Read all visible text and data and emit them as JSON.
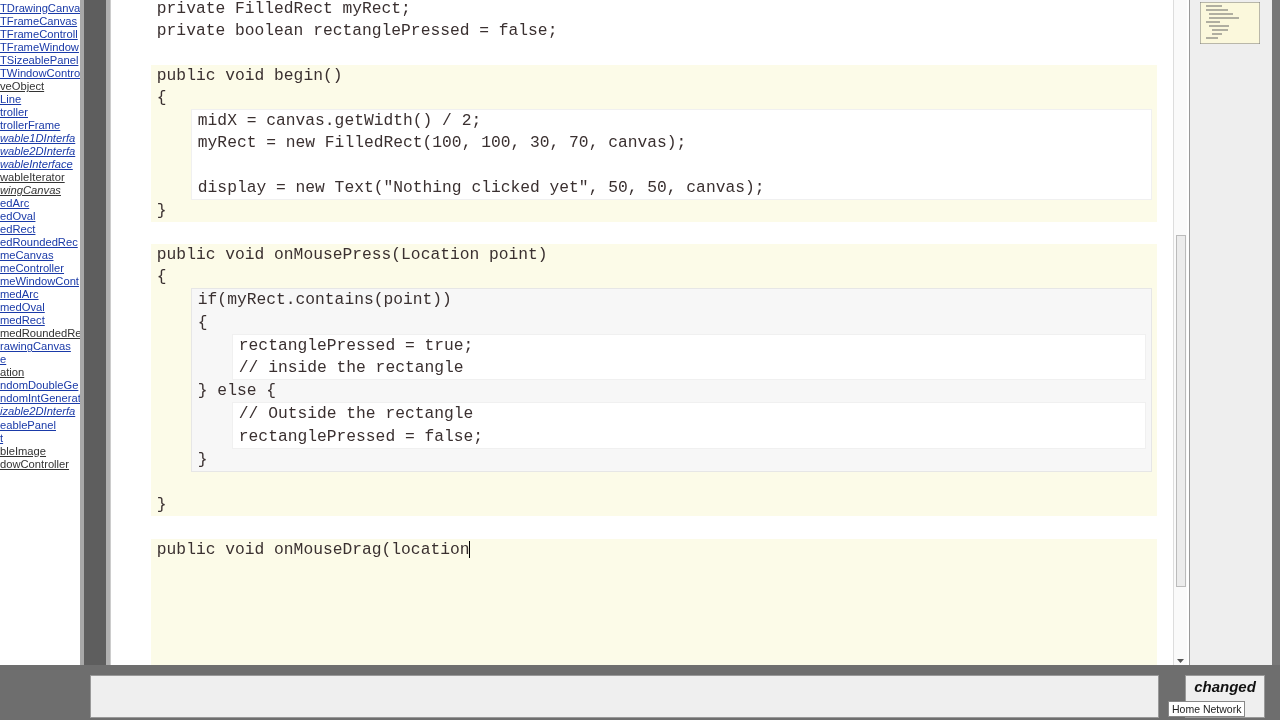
{
  "class_list": [
    {
      "text": "TDrawingCanva",
      "italic": false,
      "visited": false
    },
    {
      "text": "TFrameCanvas",
      "italic": false,
      "visited": false
    },
    {
      "text": "TFrameControll",
      "italic": false,
      "visited": false
    },
    {
      "text": "TFrameWindow",
      "italic": false,
      "visited": false
    },
    {
      "text": "TSizeablePanel",
      "italic": false,
      "visited": false
    },
    {
      "text": "TWindowContro",
      "italic": false,
      "visited": false
    },
    {
      "text": "veObject",
      "italic": false,
      "visited": true
    },
    {
      "text": "Line",
      "italic": false,
      "visited": false
    },
    {
      "text": "troller",
      "italic": false,
      "visited": false
    },
    {
      "text": "trollerFrame",
      "italic": false,
      "visited": false
    },
    {
      "text": "wable1DInterfa",
      "italic": true,
      "visited": false
    },
    {
      "text": "wable2DInterfa",
      "italic": true,
      "visited": false
    },
    {
      "text": "wableInterface",
      "italic": true,
      "visited": false
    },
    {
      "text": "wableIterator",
      "italic": false,
      "visited": true
    },
    {
      "text": "wingCanvas",
      "italic": true,
      "visited": true
    },
    {
      "text": "edArc",
      "italic": false,
      "visited": false
    },
    {
      "text": "edOval",
      "italic": false,
      "visited": false
    },
    {
      "text": "edRect",
      "italic": false,
      "visited": false
    },
    {
      "text": "edRoundedRec",
      "italic": false,
      "visited": false
    },
    {
      "text": "meCanvas",
      "italic": false,
      "visited": false
    },
    {
      "text": "meController",
      "italic": false,
      "visited": false
    },
    {
      "text": "meWindowCont",
      "italic": false,
      "visited": false
    },
    {
      "text": "medArc",
      "italic": false,
      "visited": false
    },
    {
      "text": "medOval",
      "italic": false,
      "visited": false
    },
    {
      "text": "medRect",
      "italic": false,
      "visited": false
    },
    {
      "text": "medRoundedRe",
      "italic": false,
      "visited": true
    },
    {
      "text": "rawingCanvas",
      "italic": false,
      "visited": false
    },
    {
      "text": "e",
      "italic": false,
      "visited": false
    },
    {
      "text": "ation",
      "italic": false,
      "visited": true
    },
    {
      "text": "ndomDoubleGe",
      "italic": false,
      "visited": false
    },
    {
      "text": "ndomIntGenerat",
      "italic": false,
      "visited": false
    },
    {
      "text": "izable2DInterfa",
      "italic": true,
      "visited": false
    },
    {
      "text": "eablePanel",
      "italic": false,
      "visited": false
    },
    {
      "text": "t",
      "italic": false,
      "visited": false
    },
    {
      "text": "bleImage",
      "italic": false,
      "visited": true
    },
    {
      "text": "dowController",
      "italic": false,
      "visited": true
    }
  ],
  "code": [
    {
      "kind": "line",
      "text": "private FilledRect myRect;"
    },
    {
      "kind": "line",
      "text": "private boolean rectanglePressed = false;"
    },
    {
      "kind": "blank"
    },
    {
      "kind": "method",
      "children": [
        {
          "kind": "line",
          "text": "public void begin()"
        },
        {
          "kind": "line",
          "text": "{"
        },
        {
          "kind": "scope",
          "children": [
            {
              "kind": "line",
              "text": "midX = canvas.getWidth() / 2;"
            },
            {
              "kind": "line",
              "text": "myRect = new FilledRect(100, 100, 30, 70, canvas);"
            },
            {
              "kind": "blank"
            },
            {
              "kind": "line",
              "text": "display = new Text(\"Nothing clicked yet\", 50, 50, canvas);"
            }
          ]
        },
        {
          "kind": "line",
          "text": "}"
        }
      ]
    },
    {
      "kind": "blank"
    },
    {
      "kind": "method",
      "children": [
        {
          "kind": "line",
          "text": "public void onMousePress(Location point)"
        },
        {
          "kind": "line",
          "text": "{"
        },
        {
          "kind": "branch",
          "children": [
            {
              "kind": "line",
              "text": "if(myRect.contains(point))"
            },
            {
              "kind": "line",
              "text": "{"
            },
            {
              "kind": "scope",
              "children": [
                {
                  "kind": "line",
                  "text": "rectanglePressed = true;"
                },
                {
                  "kind": "line",
                  "text": "// inside the rectangle"
                }
              ]
            },
            {
              "kind": "line",
              "text": "} else {"
            },
            {
              "kind": "scope",
              "children": [
                {
                  "kind": "line",
                  "text": "// Outside the rectangle"
                },
                {
                  "kind": "line",
                  "text": "rectanglePressed = false;"
                }
              ]
            },
            {
              "kind": "line",
              "text": "}"
            }
          ]
        },
        {
          "kind": "blank"
        },
        {
          "kind": "line",
          "text": "}"
        }
      ]
    },
    {
      "kind": "blank"
    },
    {
      "kind": "method",
      "open": true,
      "children": [
        {
          "kind": "line",
          "text": "public void onMouseDrag(location",
          "caret": true
        }
      ]
    }
  ],
  "status_button": "changed",
  "tooltip": "Home Network"
}
